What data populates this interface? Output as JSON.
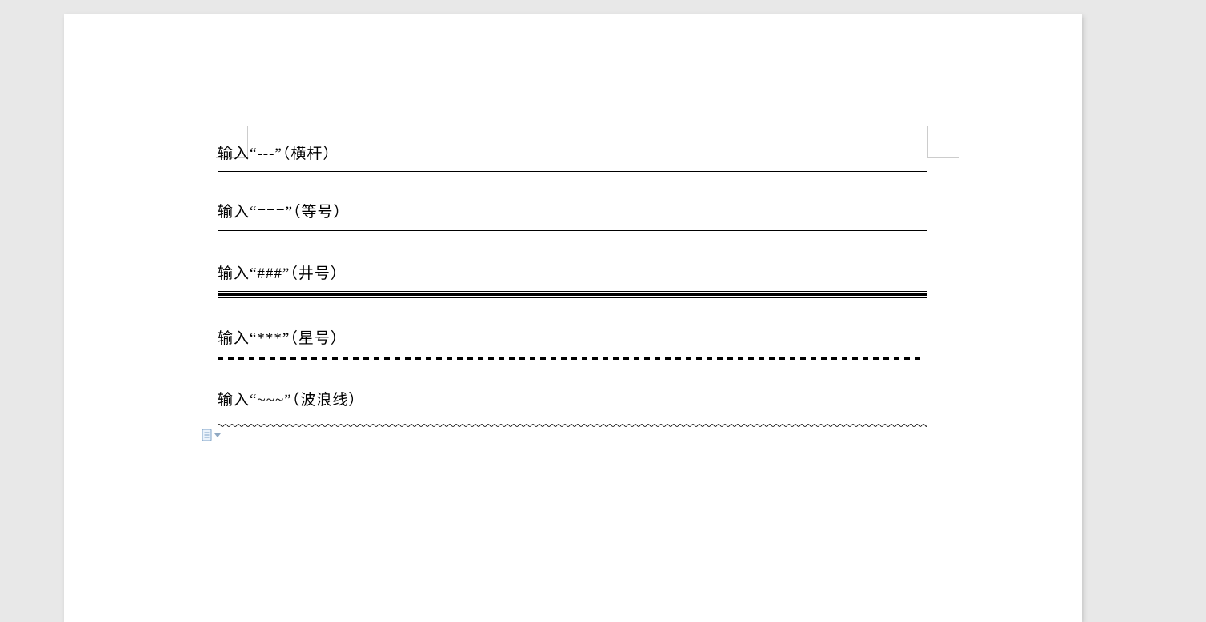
{
  "document": {
    "lines": [
      {
        "label": "输入“---”（横杆）",
        "style": "thin"
      },
      {
        "label": "输入“===”（等号）",
        "style": "double"
      },
      {
        "label": "输入“###”（井号）",
        "style": "triple"
      },
      {
        "label": "输入“***”（星号）",
        "style": "dotted"
      },
      {
        "label": "输入“~~~”（波浪线）",
        "style": "wavy"
      }
    ]
  },
  "icons": {
    "paste_options": "paste-options"
  }
}
